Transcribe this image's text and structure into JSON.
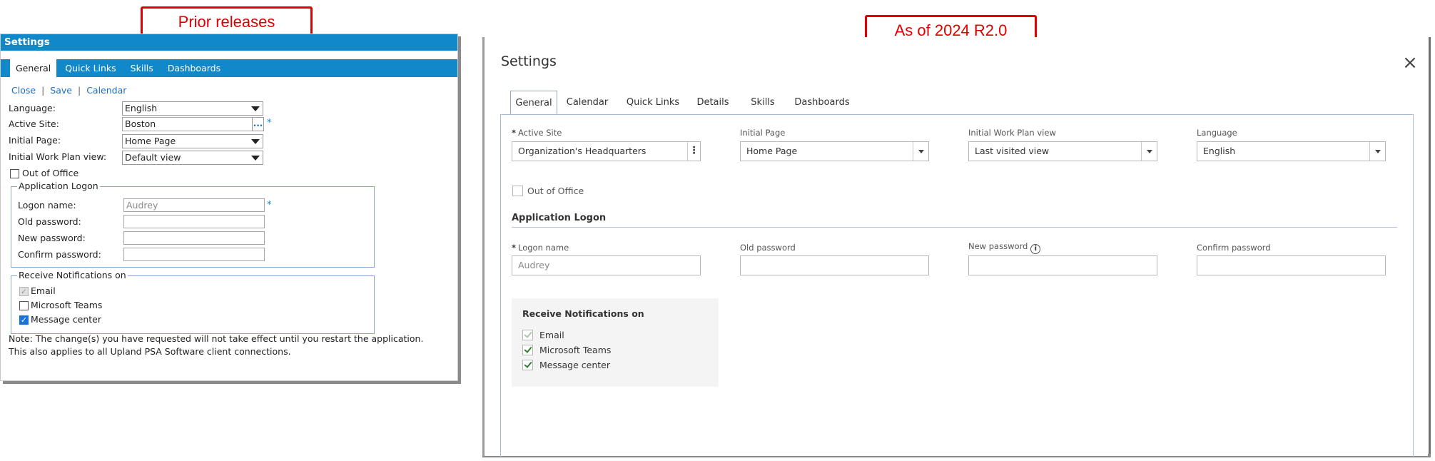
{
  "callouts": {
    "prior": "Prior releases",
    "current": "As of 2024 R2.0"
  },
  "old": {
    "title": "Settings",
    "tabs": [
      {
        "label": "General",
        "active": true
      },
      {
        "label": "Quick Links"
      },
      {
        "label": "Skills"
      },
      {
        "label": "Dashboards"
      }
    ],
    "links": {
      "close": "Close",
      "save": "Save",
      "calendar": "Calendar",
      "sep": "|"
    },
    "fields": {
      "language_label": "Language:",
      "language_value": "English",
      "site_label": "Active Site:",
      "site_value": "Boston",
      "site_more": "...",
      "page_label": "Initial Page:",
      "page_value": "Home Page",
      "workplan_label": "Initial Work Plan view:",
      "workplan_value": "Default view",
      "required": "*"
    },
    "out_of_office": "Out of Office",
    "logon": {
      "legend": "Application Logon",
      "logon_label": "Logon name:",
      "logon_value": "Audrey",
      "old_pw": "Old password:",
      "new_pw": "New password:",
      "confirm_pw": "Confirm password:"
    },
    "notifications": {
      "legend": "Receive Notifications on",
      "email": "Email",
      "teams": "Microsoft Teams",
      "message": "Message center"
    },
    "note_line1": "Note: The change(s) you have requested will not take effect until you restart the application.",
    "note_line2": "This also applies to all Upland PSA Software client connections."
  },
  "new": {
    "title": "Settings",
    "close": "×",
    "tabs": [
      {
        "label": "General",
        "active": true
      },
      {
        "label": "Calendar"
      },
      {
        "label": "Quick Links"
      },
      {
        "label": "Details"
      },
      {
        "label": "Skills"
      },
      {
        "label": "Dashboards"
      }
    ],
    "star": "*",
    "active_site_label": "Active Site",
    "active_site_value": "Organization's Headquarters",
    "initial_page_label": "Initial Page",
    "initial_page_value": "Home Page",
    "workplan_label": "Initial Work Plan view",
    "workplan_value": "Last visited view",
    "language_label": "Language",
    "language_value": "English",
    "out_of_office": "Out of Office",
    "app_logon": "Application Logon",
    "logon_label": "Logon name",
    "logon_placeholder": "Audrey",
    "old_pw_label": "Old password",
    "new_pw_label": "New password",
    "info": "i",
    "confirm_pw_label": "Confirm password",
    "notifications": {
      "title": "Receive Notifications on",
      "email": "Email",
      "teams": "Microsoft Teams",
      "message": "Message center"
    }
  }
}
